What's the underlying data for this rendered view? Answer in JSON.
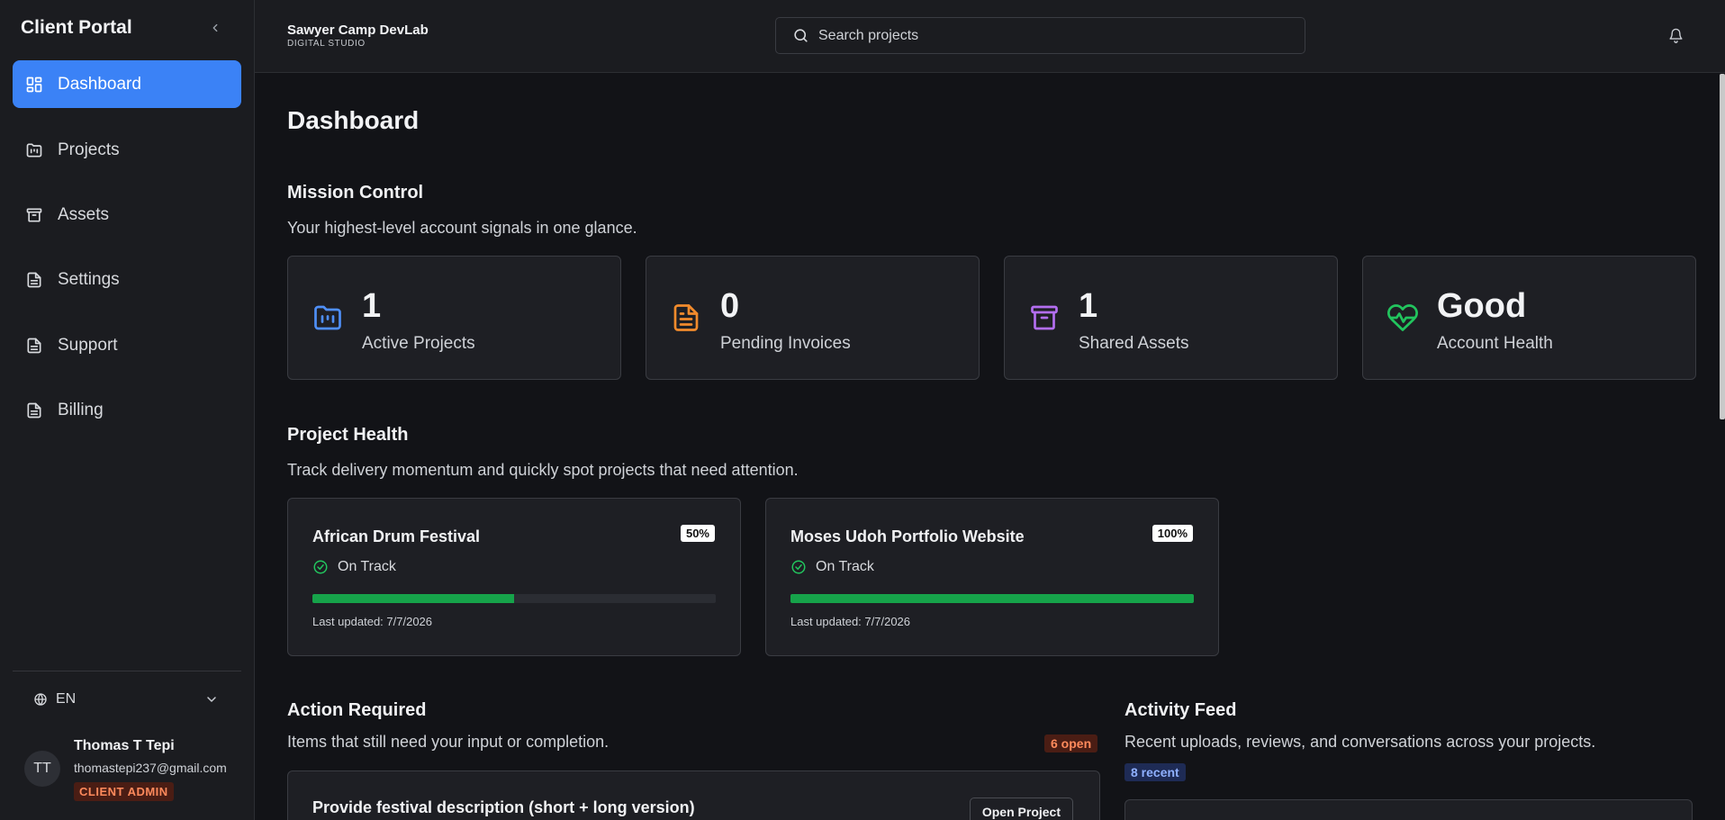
{
  "sidebar": {
    "brand": "Client Portal",
    "items": [
      {
        "label": "Dashboard",
        "icon": "dashboard-icon"
      },
      {
        "label": "Projects",
        "icon": "folder-icon"
      },
      {
        "label": "Assets",
        "icon": "archive-icon"
      },
      {
        "label": "Settings",
        "icon": "document-icon"
      },
      {
        "label": "Support",
        "icon": "document-icon"
      },
      {
        "label": "Billing",
        "icon": "document-icon"
      }
    ],
    "language": "EN",
    "user": {
      "initials": "TT",
      "name": "Thomas T Tepi",
      "email": "thomastepi237@gmail.com",
      "role": "CLIENT ADMIN"
    }
  },
  "header": {
    "org_name": "Sawyer Camp DevLab",
    "org_sub": "DIGITAL STUDIO",
    "search_placeholder": "Search projects"
  },
  "main": {
    "title": "Dashboard",
    "mission": {
      "title": "Mission Control",
      "desc": "Your highest-level account signals in one glance.",
      "stats": [
        {
          "value": "1",
          "label": "Active Projects",
          "color": "#4f8ff7"
        },
        {
          "value": "0",
          "label": "Pending Invoices",
          "color": "#f28b2c"
        },
        {
          "value": "1",
          "label": "Shared Assets",
          "color": "#b36ef0"
        },
        {
          "value": "Good",
          "label": "Account Health",
          "color": "#22c55e"
        }
      ]
    },
    "health": {
      "title": "Project Health",
      "desc": "Track delivery momentum and quickly spot projects that need attention.",
      "projects": [
        {
          "name": "African Drum Festival",
          "percent": "50%",
          "progress": 0.5,
          "status": "On Track",
          "updated": "Last updated: 7/7/2026"
        },
        {
          "name": "Moses Udoh Portfolio Website",
          "percent": "100%",
          "progress": 1.0,
          "status": "On Track",
          "updated": "Last updated: 7/7/2026"
        }
      ]
    },
    "action": {
      "title": "Action Required",
      "desc": "Items that still need your input or completion.",
      "badge": "6 open",
      "first_item": "Provide festival description (short + long version)",
      "button": "Open Project"
    },
    "feed": {
      "title": "Activity Feed",
      "desc": "Recent uploads, reviews, and conversations across your projects.",
      "badge": "8 recent"
    }
  },
  "colors": {
    "accent": "#3b82f6",
    "progress": "#16a34a",
    "ok": "#22c55e"
  }
}
